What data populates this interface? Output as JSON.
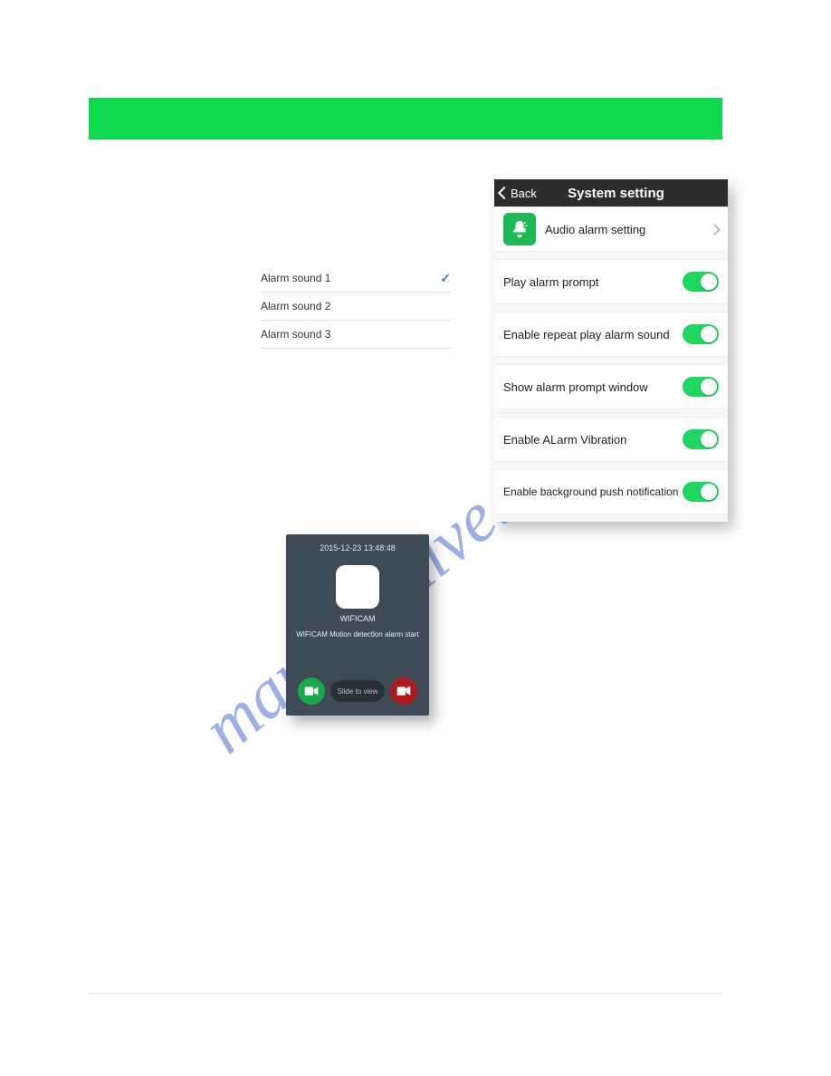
{
  "watermark": "manualshive.com",
  "sound_list": {
    "items": [
      {
        "label": "Alarm sound 1",
        "selected": true
      },
      {
        "label": "Alarm sound 2",
        "selected": false
      },
      {
        "label": "Alarm sound 3",
        "selected": false
      }
    ]
  },
  "system_setting": {
    "back_label": "Back",
    "title": "System setting",
    "audio_row": "Audio alarm setting",
    "toggles": [
      {
        "label": "Play alarm prompt",
        "on": true
      },
      {
        "label": "Enable repeat play alarm sound",
        "on": true
      },
      {
        "label": "Show alarm prompt window",
        "on": true
      },
      {
        "label": "Enable ALarm Vibration",
        "on": true
      },
      {
        "label": "Enable background push notification",
        "on": true
      }
    ]
  },
  "popup": {
    "timestamp": "2015-12-23 13:48:48",
    "app_name": "WIFICAM",
    "message": "WIFICAM Motion detection alarm start",
    "slide_label": "Slide to view"
  }
}
